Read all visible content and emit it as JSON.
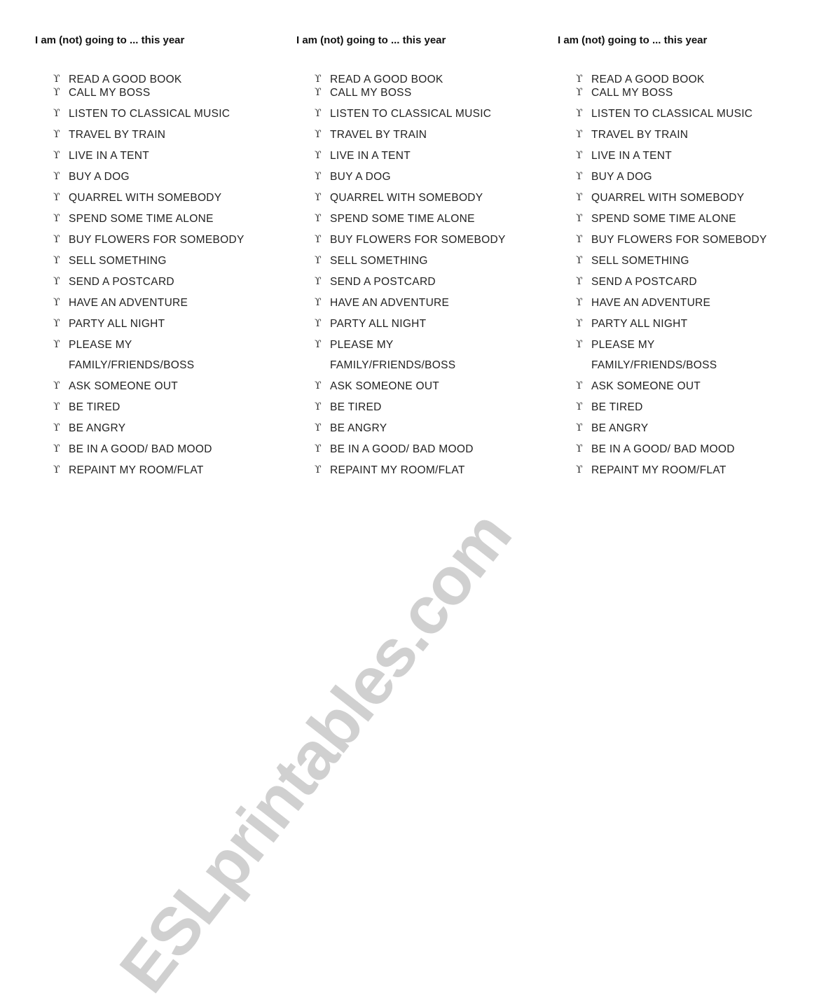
{
  "worksheet": {
    "columns": [
      {
        "title": "I am (not) going to ... this year",
        "items": [
          {
            "text": "READ A GOOD BOOK"
          },
          {
            "text": "CALL MY BOSS"
          },
          {
            "text": "LISTEN TO CLASSICAL MUSIC"
          },
          {
            "text": "TRAVEL BY TRAIN"
          },
          {
            "text": "LIVE IN A TENT"
          },
          {
            "text": "BUY A DOG"
          },
          {
            "text": "QUARREL WITH SOMEBODY"
          },
          {
            "text": "SPEND SOME TIME ALONE"
          },
          {
            "text": "BUY FLOWERS FOR SOMEBODY"
          },
          {
            "text": "SELL SOMETHING"
          },
          {
            "text": "SEND A POSTCARD"
          },
          {
            "text": "HAVE AN ADVENTURE"
          },
          {
            "text": "PARTY ALL NIGHT"
          },
          {
            "text": "PLEASE MY",
            "continuation": "FAMILY/FRIENDS/BOSS"
          },
          {
            "text": "ASK SOMEONE OUT"
          },
          {
            "text": "BE TIRED"
          },
          {
            "text": "BE ANGRY"
          },
          {
            "text": "BE IN A GOOD/ BAD MOOD"
          },
          {
            "text": "REPAINT MY ROOM/FLAT"
          }
        ]
      },
      {
        "title": "I am (not) going to ... this year",
        "items": [
          {
            "text": "READ A GOOD BOOK"
          },
          {
            "text": "CALL MY BOSS"
          },
          {
            "text": "LISTEN TO CLASSICAL MUSIC"
          },
          {
            "text": "TRAVEL BY TRAIN"
          },
          {
            "text": "LIVE IN A TENT"
          },
          {
            "text": "BUY A DOG"
          },
          {
            "text": "QUARREL WITH SOMEBODY"
          },
          {
            "text": "SPEND SOME TIME ALONE"
          },
          {
            "text": "BUY FLOWERS FOR SOMEBODY"
          },
          {
            "text": "SELL SOMETHING"
          },
          {
            "text": "SEND A POSTCARD"
          },
          {
            "text": "HAVE AN ADVENTURE"
          },
          {
            "text": "PARTY ALL NIGHT"
          },
          {
            "text": "PLEASE MY",
            "continuation": "FAMILY/FRIENDS/BOSS"
          },
          {
            "text": "ASK SOMEONE OUT"
          },
          {
            "text": "BE TIRED"
          },
          {
            "text": "BE ANGRY"
          },
          {
            "text": "BE IN A GOOD/ BAD MOOD"
          },
          {
            "text": "REPAINT MY ROOM/FLAT"
          }
        ]
      },
      {
        "title": "I am (not) going to ... this year",
        "items": [
          {
            "text": "READ A GOOD BOOK"
          },
          {
            "text": "CALL MY BOSS"
          },
          {
            "text": "LISTEN TO CLASSICAL MUSIC"
          },
          {
            "text": "TRAVEL BY TRAIN"
          },
          {
            "text": "LIVE IN A TENT"
          },
          {
            "text": "BUY A DOG"
          },
          {
            "text": "QUARREL WITH SOMEBODY"
          },
          {
            "text": "SPEND SOME TIME ALONE"
          },
          {
            "text": "BUY FLOWERS FOR SOMEBODY"
          },
          {
            "text": "SELL SOMETHING"
          },
          {
            "text": "SEND A POSTCARD"
          },
          {
            "text": "HAVE AN ADVENTURE"
          },
          {
            "text": "PARTY ALL NIGHT"
          },
          {
            "text": "PLEASE MY",
            "continuation": "FAMILY/FRIENDS/BOSS"
          },
          {
            "text": "ASK SOMEONE OUT"
          },
          {
            "text": "BE TIRED"
          },
          {
            "text": "BE ANGRY"
          },
          {
            "text": "BE IN A GOOD/ BAD MOOD"
          },
          {
            "text": "REPAINT MY ROOM/FLAT"
          }
        ]
      }
    ],
    "bullet_glyph": "ϒ",
    "bullet_icon": "upsilon-hook-bullet-icon"
  },
  "watermark": {
    "text": "ESLprintables.com",
    "color": "#c8c8c8"
  }
}
